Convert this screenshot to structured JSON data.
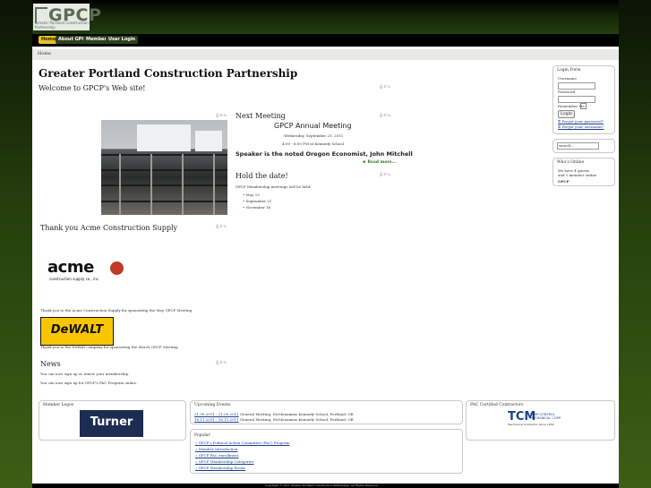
{
  "logo": {
    "text": "GPCP",
    "subtitle": "Greater Portland Construction Partnership"
  },
  "nav": {
    "items": [
      "Home",
      "About GPCP",
      "Members",
      "User Login"
    ]
  },
  "breadcrumb": "Home",
  "page_title": "Greater Portland Construction Partnership",
  "welcome": "Welcome to GPCP's Web site!",
  "next_meeting": {
    "heading": "Next Meeting",
    "title": "GPCP Annual Meeting",
    "date": "Wednesday, September 21, 2011",
    "time": "4:00 - 6:00 PM at Kennedy School",
    "speaker": "Speaker is the noted Oregon Economist, John Mitchell",
    "read_more": "Read more..."
  },
  "hold_date": {
    "heading": "Hold the date!",
    "intro": "GPCP Membership meetings will be held:",
    "dates": [
      "May 23",
      "September 21",
      "November 16"
    ]
  },
  "thanks_acme": {
    "heading": "Thank you Acme Construction Supply",
    "logo_text": "acme",
    "logo_sub": "construction supply co., inc.",
    "caption": "Thank you to the Acme Construction Supply for sponsoring the May GPCP Meeting"
  },
  "thanks_dewalt": {
    "logo_text": "DeWALT",
    "caption": "Thank you to the DeWalt company for sponsoring the March GPCP Meeting"
  },
  "news": {
    "heading": "News",
    "line1": "You can now sign up or renew your membership.",
    "line2": "You can now sign up for GPCP's PAC Program online."
  },
  "login_form": {
    "title": "Login Form",
    "username_label": "Username",
    "password_label": "Password",
    "remember_label": "Remember Me",
    "login_button": "Login",
    "forgot_password": "Forgot your password?",
    "forgot_username": "Forgot your username?"
  },
  "search": {
    "placeholder": "search..."
  },
  "whos_online": {
    "title": "Who's Online",
    "text": "We have 4 guests and 1 member online",
    "member": "GPCP"
  },
  "member_logos": {
    "title": "Member Logos",
    "logo_text": "Turner"
  },
  "upcoming_events": {
    "title": "Upcoming Events",
    "events": [
      {
        "date": "21.09.2011 - 21.09.2011",
        "text": "General Meeting, McMenamins Kennedy School, Portland, OR"
      },
      {
        "date": "16.11.2011 - 16.11.2011",
        "text": "General Meeting, McMenamins Kennedy School, Portland, OR"
      }
    ]
  },
  "pac_contractors": {
    "title": "PAC Certified Contractors",
    "logo_text": "TCM",
    "logo_sub": "TEMP-CONTROL MECHANICAL CORP.",
    "logo_tagline": "Mechanical Contractor Since 1958"
  },
  "popular": {
    "title": "Popular",
    "items": [
      "GPCP's Political Action Committee (PAC) Program",
      "Member Introduction",
      "GPCP PAC enrollment",
      "GPCP Membership Categories",
      "GPCP Membership Forms"
    ]
  },
  "footer": "Copyright © 2011 Greater Portland Construction Partnership. All Rights Reserved."
}
